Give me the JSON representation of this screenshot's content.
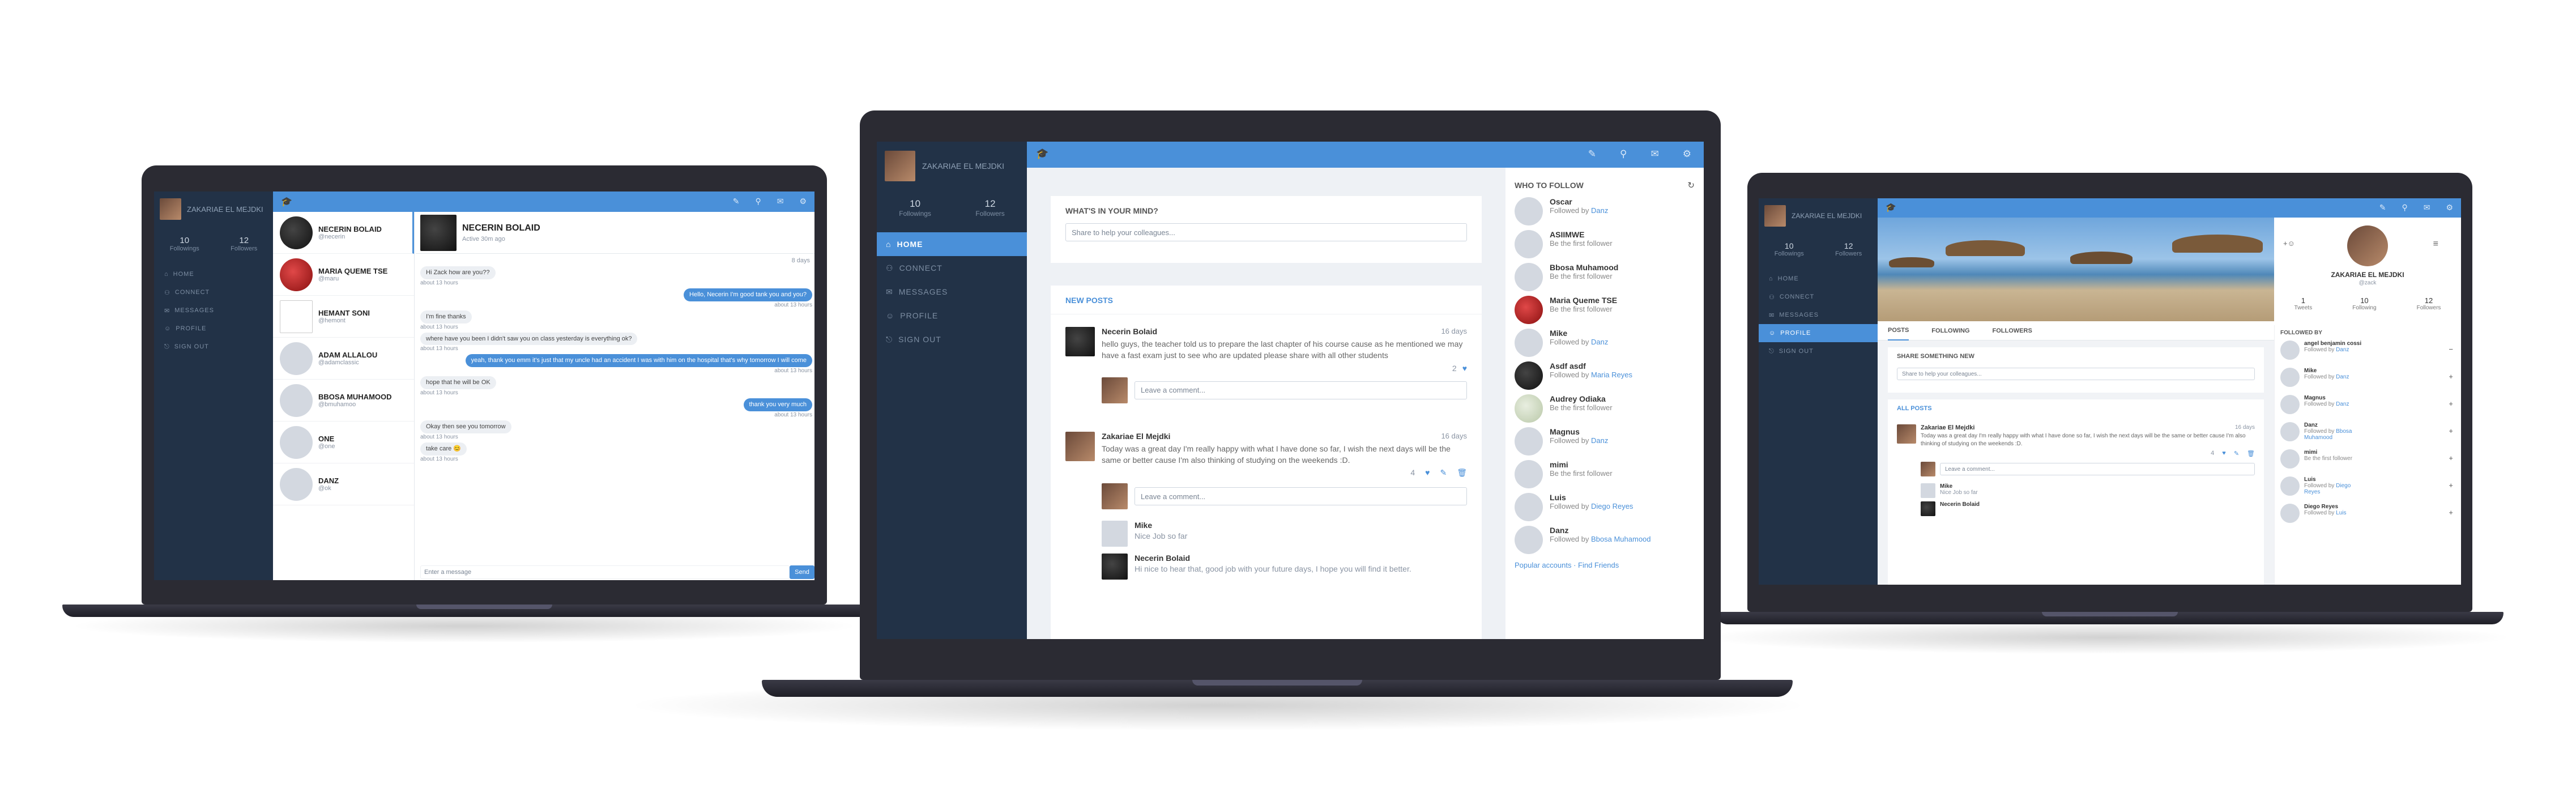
{
  "sidebar": {
    "user_name": "ZAKARIAE EL MEJDKI",
    "following_count": "10",
    "following_label": "Followings",
    "followers_count": "12",
    "followers_label": "Followers",
    "nav": [
      "HOME",
      "CONNECT",
      "MESSAGES",
      "PROFILE",
      "SIGN OUT"
    ]
  },
  "messages_screen": {
    "contacts": [
      {
        "name": "NECERIN BOLAID",
        "handle": "@necerin"
      },
      {
        "name": "MARIA QUEME TSE",
        "handle": "@maru"
      },
      {
        "name": "HEMANT SONI",
        "handle": "@hemont"
      },
      {
        "name": "ADAM ALLALOU",
        "handle": "@adamclassic"
      },
      {
        "name": "BBOSA MUHAMOOD",
        "handle": "@bmuhamoo"
      },
      {
        "name": "ONE",
        "handle": "@one"
      },
      {
        "name": "DANZ",
        "handle": "@ok"
      }
    ],
    "chat_name": "NECERIN BOLAID",
    "chat_status": "Active 30m ago",
    "chat_date": "8 days",
    "chat": [
      {
        "side": "left",
        "text": "Hi Zack how are you??",
        "time": "about 13 hours"
      },
      {
        "side": "right",
        "text": "Hello, Necerin I'm good tank you and you?",
        "time": "about 13 hours"
      },
      {
        "side": "left",
        "text": "I'm fine thanks",
        "time": "about 13 hours"
      },
      {
        "side": "left",
        "text": "where have you been I didn't saw you on class yesterday is everything ok?",
        "time": "about 13 hours"
      },
      {
        "side": "right",
        "text": "yeah, thank you emm it's just that my uncle had an accident I was with him on the hospital that's why tomorrow I will come",
        "time": "about 13 hours"
      },
      {
        "side": "left",
        "text": "hope that he will be OK",
        "time": "about 13 hours"
      },
      {
        "side": "right",
        "text": "thank you very much",
        "time": "about 13 hours"
      },
      {
        "side": "left",
        "text": "Okay then see you tomorrow",
        "time": "about 13 hours"
      },
      {
        "side": "left",
        "text": "take care 😊",
        "time": "about 13 hours"
      }
    ],
    "input_placeholder": "Enter a message",
    "send_label": "Send"
  },
  "home_screen": {
    "composer_title": "WHAT'S IN YOUR MIND?",
    "composer_placeholder": "Share to help your colleagues...",
    "new_posts_title": "NEW POSTS",
    "posts": [
      {
        "author": "Necerin Bolaid",
        "date": "16 days",
        "text": "hello guys, the teacher told us to prepare the last chapter of his course cause as he mentioned we may have a fast exam just to see who are updated please share with all other students",
        "likes": "2"
      },
      {
        "author": "Zakariae El Mejdki",
        "date": "16 days",
        "text": "Today was a great day I'm really happy with what I have done so far, I wish the next days will be the same or better cause I'm also thinking of studying on the weekends :D.",
        "likes": "4"
      }
    ],
    "comment_placeholder": "Leave a comment...",
    "comments": [
      {
        "author": "Mike",
        "text": "Nice Job so far"
      },
      {
        "author": "Necerin Bolaid",
        "text": "Hi nice to hear that, good job with your future days, I hope you will find it better."
      }
    ],
    "who_to_follow_title": "WHO TO FOLLOW",
    "suggestions": [
      {
        "name": "Oscar",
        "prefix": "Followed by",
        "by": "Danz"
      },
      {
        "name": "ASIIMWE",
        "prefix": "Be the first follower",
        "by": ""
      },
      {
        "name": "Bbosa Muhamood",
        "prefix": "Be the first follower",
        "by": ""
      },
      {
        "name": "Maria Queme TSE",
        "prefix": "Be the first follower",
        "by": ""
      },
      {
        "name": "Mike",
        "prefix": "Followed by",
        "by": "Danz"
      },
      {
        "name": "Asdf asdf",
        "prefix": "Followed by",
        "by": "Maria Reyes"
      },
      {
        "name": "Audrey Odiaka",
        "prefix": "Be the first follower",
        "by": ""
      },
      {
        "name": "Magnus",
        "prefix": "Followed by",
        "by": "Danz"
      },
      {
        "name": "mimi",
        "prefix": "Be the first follower",
        "by": ""
      },
      {
        "name": "Luis",
        "prefix": "Followed by",
        "by": "Diego Reyes"
      },
      {
        "name": "Danz",
        "prefix": "Followed by",
        "by": "Bbosa Muhamood"
      }
    ],
    "footer_links": "Popular accounts · Find Friends"
  },
  "profile_screen": {
    "name": "ZAKARIAE EL MEJDKI",
    "handle": "@zack",
    "stats": [
      {
        "value": "1",
        "label": "Tweets"
      },
      {
        "value": "10",
        "label": "Following"
      },
      {
        "value": "12",
        "label": "Followers"
      }
    ],
    "tabs": [
      "POSTS",
      "FOLLOWING",
      "FOLLOWERS"
    ],
    "share_title": "SHARE SOMETHING NEW",
    "share_placeholder": "Share to help your colleagues...",
    "all_posts_title": "ALL POSTS",
    "post_author": "Zakariae El Mejdki",
    "post_date": "16 days",
    "post_text": "Today was a great day I'm really happy with what I have done so far, I wish the next days will be the same or better cause I'm also thinking of studying on the weekends :D.",
    "post_likes": "4",
    "comment_placeholder": "Leave a comment...",
    "comment_author": "Mike",
    "comment_text": "Nice Job so far",
    "next_comment_author": "Necerin Bolaid",
    "followed_by_title": "FOLLOWED BY",
    "followers": [
      {
        "name": "angel benjamin cossi",
        "prefix": "Followed by",
        "by": "Danz"
      },
      {
        "name": "Mike",
        "prefix": "Followed by",
        "by": "Danz"
      },
      {
        "name": "Magnus",
        "prefix": "Followed by",
        "by": "Danz"
      },
      {
        "name": "Danz",
        "prefix": "Followed by",
        "by": "Bbosa Muhamood"
      },
      {
        "name": "mimi",
        "prefix": "Be the first follower",
        "by": ""
      },
      {
        "name": "Luis",
        "prefix": "Followed by",
        "by": "Diego Reyes"
      },
      {
        "name": "Diego Reyes",
        "prefix": "Followed by",
        "by": "Luis"
      }
    ]
  },
  "colors": {
    "accent": "#4a90d9",
    "sidebar": "#223247",
    "laptop_body": "#2b2b33"
  }
}
